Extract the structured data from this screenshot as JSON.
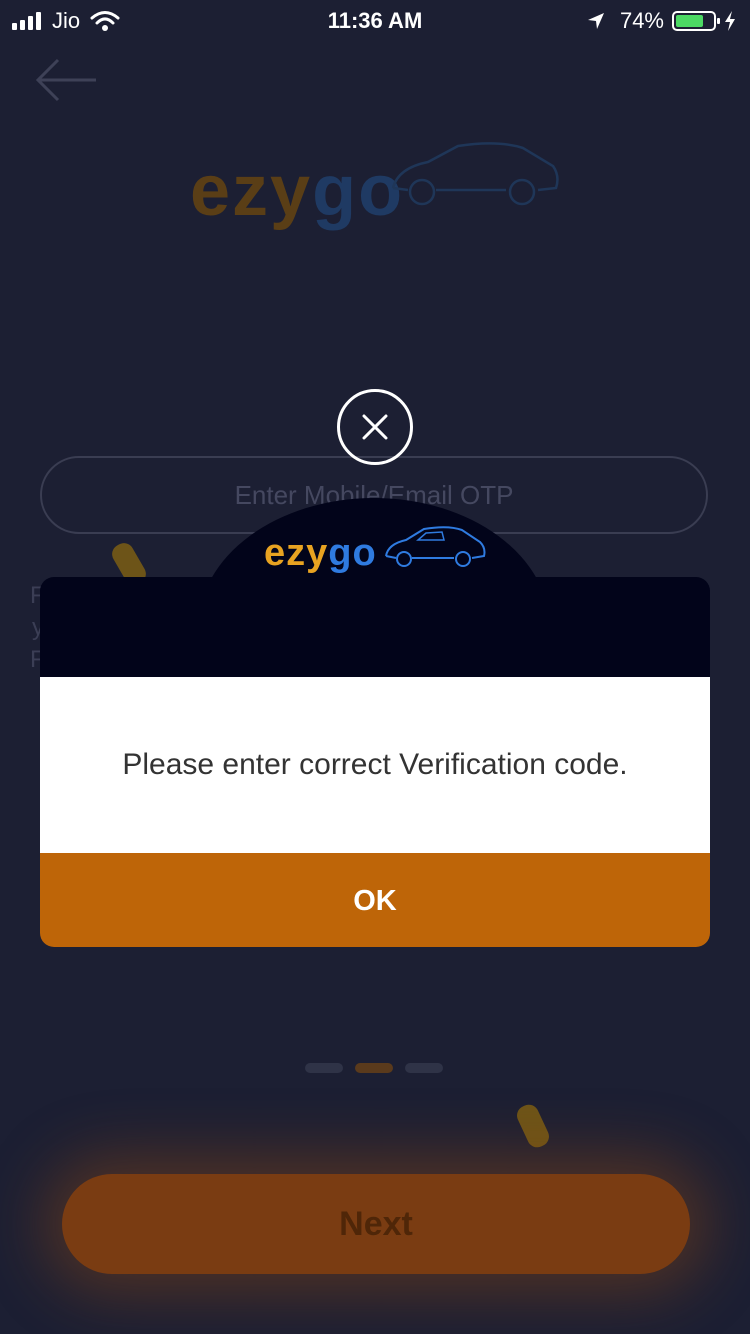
{
  "status_bar": {
    "carrier": "Jio",
    "time": "11:36 AM",
    "battery_percent": "74%",
    "battery_level": 0.74,
    "battery_color": "#4cd964"
  },
  "background": {
    "back_icon": "arrow-left-icon",
    "logo": {
      "ezy": "ezy",
      "go": "go"
    },
    "otp_placeholder": "Enter Mobile/Email OTP",
    "next_label": "Next",
    "page_indicator": {
      "count": 3,
      "active_index": 1
    }
  },
  "dialog": {
    "close_icon": "close-icon",
    "logo": {
      "ezy": "ezy",
      "go": "go"
    },
    "message": "Please enter correct Verification code.",
    "ok_label": "OK",
    "colors": {
      "header": "#02041a",
      "accent": "#be6508",
      "logo_orange": "#e8a321",
      "logo_blue": "#2f7be0"
    }
  }
}
